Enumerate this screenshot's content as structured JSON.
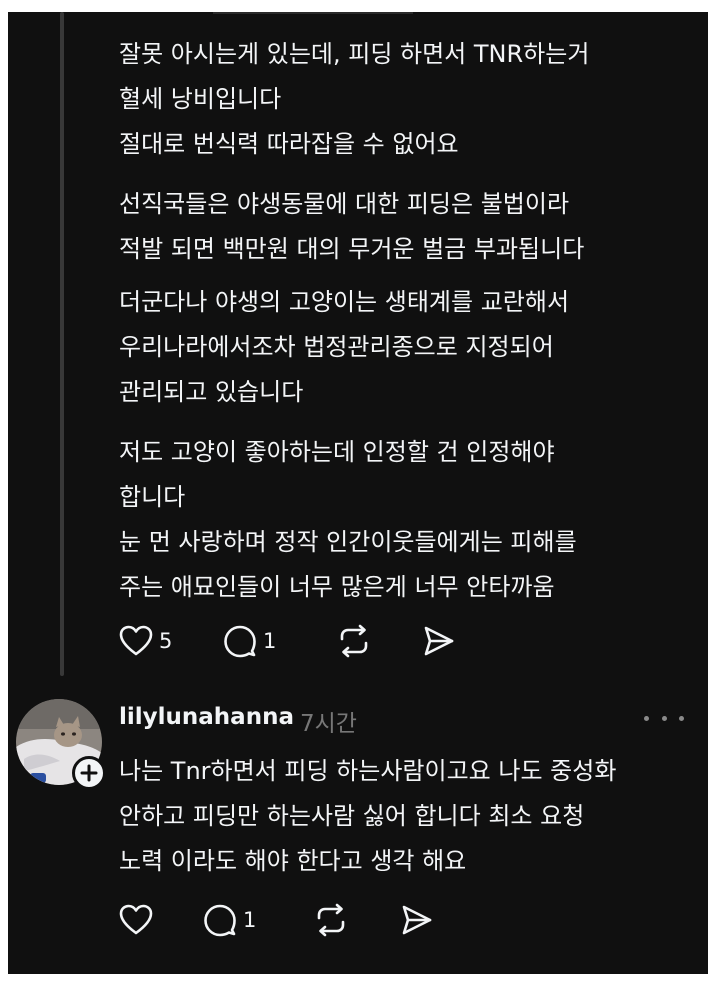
{
  "comment_1": {
    "paragraphs": [
      "잘못 아시는게 있는데, 피딩 하면서 TNR하는거\n혈세 낭비입니다\n절대로 번식력 따라잡을 수 없어요",
      "선직국들은 야생동물에 대한 피딩은 불법이라\n적발 되면 백만원 대의 무거운 벌금 부과됩니다",
      "더군다나 야생의 고양이는 생태계를 교란해서\n우리나라에서조차 법정관리종으로 지정되어\n관리되고 있습니다",
      "저도 고양이 좋아하는데 인정할 건 인정해야\n합니다\n눈 먼 사랑하며 정작 인간이웃들에게는 피해를\n주는 애묘인들이 너무 많은게 너무 안타까움"
    ],
    "like_count": "5",
    "reply_count": "1"
  },
  "comment_2": {
    "username": "lilylunahanna",
    "timestamp": "7시간",
    "paragraphs": [
      "나는 Tnr하면서 피딩 하는사람이고요 나도 중성화\n안하고 피딩만 하는사람 싫어 합니다 최소 요청\n노력 이라도 해야 한다고 생각 해요"
    ],
    "reply_count": "1"
  },
  "icons": {
    "like": "heart-icon",
    "reply": "comment-bubble-icon",
    "repost": "repost-icon",
    "share": "send-icon",
    "more": "more-dots-icon",
    "follow": "plus-icon"
  },
  "colors": {
    "background": "#101010",
    "text": "#f3f5f7",
    "muted": "#777777"
  }
}
